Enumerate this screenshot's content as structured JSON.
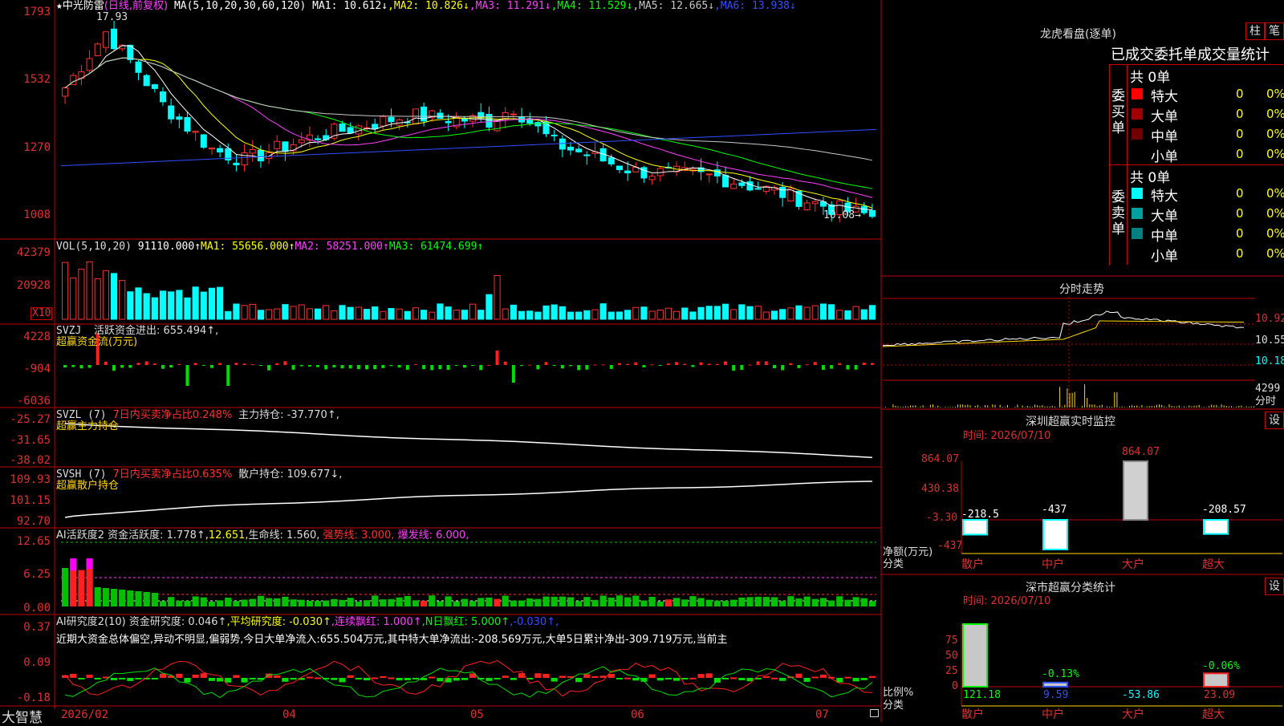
{
  "main": {
    "stock_name": "中光防雷",
    "star": "★",
    "period": "(日线,前复权)",
    "ma_label": "MA(5,10,20,30,60,120)",
    "ma": [
      {
        "label": "MA1: 10.612↓",
        "color": "#ffffff"
      },
      {
        "label": "MA2: 10.826↓",
        "color": "#ffff00"
      },
      {
        "label": "MA3: 11.291↓",
        "color": "#ff40ff"
      },
      {
        "label": "MA4: 11.529↓",
        "color": "#00ff00"
      },
      {
        "label": "MA5: 12.665↓",
        "color": "#c8c8c8"
      },
      {
        "label": "MA6: 13.938↓",
        "color": "#3050ff"
      }
    ],
    "y_ticks": [
      "1793",
      "1532",
      "1270",
      "1008"
    ],
    "high_marker": "17.93",
    "low_marker": "10.08→"
  },
  "volume": {
    "label": "VOL(5,10,20)",
    "value": "91110.000↑",
    "ma1": "MA1: 55656.000↑",
    "ma2": "MA2: 58251.000↑",
    "ma3": "MA3: 61474.699↑",
    "y_ticks": [
      "42379",
      "20928"
    ],
    "unit": "X10"
  },
  "svzj": {
    "label": "SVZJ",
    "desc": "活跃资金进出: 655.494↑,",
    "sub": "超赢资金流(万元)",
    "y_ticks": [
      "4228",
      "-904",
      "-6036"
    ]
  },
  "svzl": {
    "label": "SVZL (7)",
    "desc1": "7日内买卖净占比0.248%",
    "desc2": "主力持仓: -37.770↑,",
    "sub": "超赢主力持仓",
    "y_ticks": [
      "-25.27",
      "-31.65",
      "-38.02"
    ]
  },
  "svsh": {
    "label": "SVSH (7)",
    "desc1": "7日内买卖净占比0.635%",
    "desc2": "散户持仓: 109.677↓,",
    "sub": "超赢散户持仓",
    "y_ticks": [
      "109.93",
      "101.15",
      "92.70"
    ]
  },
  "ai1": {
    "label": "AI活跃度2",
    "p1": "资金活跃度: 1.778↑",
    "p2": ",12.651,",
    "p3": "生命线: 1.560,",
    "p4": "强势线: 3.000,",
    "p5": "爆发线: 6.000,",
    "y_ticks": [
      "12.65",
      "6.25",
      "0.00"
    ]
  },
  "ai2": {
    "label": "AI研究度2(10)",
    "p1": "资金研究度: 0.046↑",
    "p2": ",平均研究度: -0.030↑",
    "p3": ",连续飘红: 1.000↑",
    "p4": ",N日飘红: 5.000↑",
    "p5": ",-0.030↑,",
    "comment": "近期大资金总体偏空,异动不明显,偏弱势,今日大单净流入:655.504万元,其中特大单净流出:-208.569万元,大单5日累计净出-309.719万元,当前主",
    "y_ticks": [
      "0.37",
      "0.09",
      "-0.18"
    ]
  },
  "date_axis": {
    "brand": "大智慧",
    "labels": [
      "2026/02",
      "04",
      "05",
      "06",
      "07"
    ]
  },
  "dragon": {
    "title": "龙虎看盘(逐单)",
    "btn1": "柱",
    "btn2": "笔",
    "heading": "已成交委托单成交量统计",
    "buy_label": "委买单",
    "sell_label": "委卖单",
    "buy_total": "共 0单",
    "sell_total": "共 0单",
    "buy_rows": [
      {
        "name": "特大",
        "count": "0",
        "pct": "0%",
        "color": "#ff0000"
      },
      {
        "name": "大单",
        "count": "0",
        "pct": "0%",
        "color": "#a00000"
      },
      {
        "name": "中单",
        "count": "0",
        "pct": "0%",
        "color": "#700000"
      },
      {
        "name": "小单",
        "count": "0",
        "pct": "0%",
        "color": ""
      }
    ],
    "sell_rows": [
      {
        "name": "特大",
        "count": "0",
        "pct": "0%",
        "color": "#00ffff"
      },
      {
        "name": "大单",
        "count": "0",
        "pct": "0%",
        "color": "#00a0a0"
      },
      {
        "name": "中单",
        "count": "0",
        "pct": "0%",
        "color": "#008080"
      },
      {
        "name": "小单",
        "count": "0",
        "pct": "0%",
        "color": ""
      }
    ]
  },
  "intraday": {
    "title": "分时走势",
    "prices": [
      "10.92",
      "10.55",
      "10.18"
    ],
    "volume": "4299",
    "vol_label": "分时"
  },
  "monitor": {
    "title": "深圳超赢实时监控",
    "btn": "设",
    "time": "时间: 2026/07/10",
    "y_ticks": [
      "864.07",
      "430.38",
      "-3.30",
      "-437"
    ],
    "y_label": "净额(万元)",
    "x_label": "分类",
    "cats": [
      "散户",
      "中户",
      "大户",
      "超大"
    ],
    "values_label": [
      "-218.5",
      "-437",
      "864.07",
      "-208.57"
    ]
  },
  "classify": {
    "title": "深市超赢分类统计",
    "btn": "设",
    "time": "时间: 2026/07/10",
    "y_ticks": [
      "75",
      "50",
      "25",
      "0"
    ],
    "y_label": "比例%",
    "x_label": "分类",
    "cats": [
      "散户",
      "中户",
      "大户",
      "超大"
    ],
    "top_labels": [
      "",
      "-0.13%",
      "",
      "-0.06%"
    ],
    "values_label": [
      "121.18",
      "9.59",
      "-53.86",
      "23.09"
    ]
  }
}
